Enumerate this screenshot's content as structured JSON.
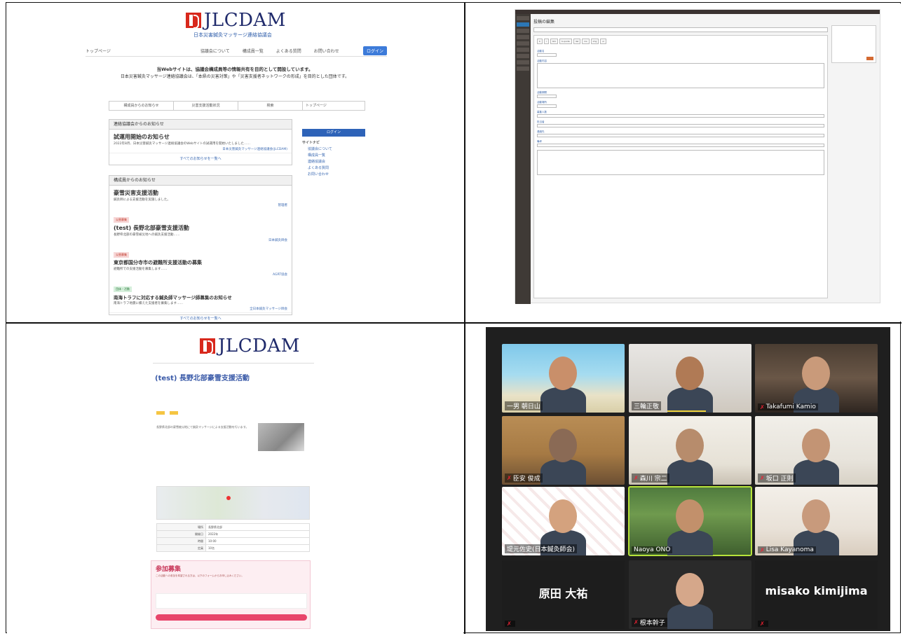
{
  "portal": {
    "logo_text": "JLCDAM",
    "logo_sub": "日本災害鍼灸マッサージ連絡協議会",
    "nav": [
      "トップページ",
      "協議会について",
      "構成員一覧",
      "よくある質問",
      "お問い合わせ",
      "ログイン"
    ],
    "intro_title": "当Webサイトは、協議会構成員等の情報共有を目的として開設しています。",
    "intro_body": "日本災害鍼灸マッサージ連絡協議会は、「本県の災害対策」や「災害支援者ネットワークの形成」を目的とした団体です。",
    "tabs": [
      "構成員からのお知らせ",
      "災害支援活動状況",
      "検索"
    ],
    "notice_header": "連絡協議会からのお知らせ",
    "notice_title": "試運用開始のお知らせ",
    "notice_text": "2022年8月、日本災害鍼灸マッサージ連絡協議会のWebサイトの試運用を開始いたしました……",
    "notice_author": "日本災害鍼灸マッサージ連絡協議会(JLCDAM)",
    "more_all": "すべてのお知らせを一覧へ",
    "member_header": "構成員からのお知らせ",
    "posts": [
      {
        "title": "豪雪災害支援活動",
        "text": "鍼灸師による支援活動を実施しました。",
        "author": "管理者"
      },
      {
        "title": "(test) 長野北部豪雪支援活動",
        "text": "長野県北部の豪雪被災地への鍼灸支援活動……",
        "author": "日本鍼灸師会"
      },
      {
        "title": "東京都国分寺市の避難所支援活動の募集",
        "text": "避難所での支援活動を募集します……",
        "author": "AGRT協会"
      },
      {
        "title": "南海トラフに対応する鍼灸師マッサージ師募集のお知らせ",
        "text": "南海トラフ地震に備えた支援者を募集します……",
        "author": "全日本鍼灸マッサージ師会"
      }
    ],
    "more_list": "すべてのお知らせを一覧へ",
    "tag_red": "災害募集",
    "tag_grn": "団体・活動",
    "side_top": "トップページ",
    "side_login": "ログイン",
    "side_nav_title": "サイトナビ",
    "side_links": [
      "協議会について",
      "構成員一覧",
      "連絡協議会",
      "よくある質問",
      "お問い合わせ"
    ]
  },
  "admin": {
    "title": "投稿の編集",
    "buttons": [
      "b",
      "i",
      "link",
      "b-quote",
      "del",
      "ins",
      "img",
      "ul",
      "ol",
      "li",
      "code",
      "more",
      "close tags"
    ],
    "fields": [
      "活動名",
      "活動内容",
      "活動期間",
      "活動場所",
      "募集人数",
      "担当者",
      "連絡先",
      "備考"
    ],
    "publish": "公開"
  },
  "event": {
    "logo_text": "JLCDAM",
    "title": "(test) 長野北部豪雪支援活動",
    "body": "長野県北部の豪雪被災地にて鍼灸マッサージによる支援活動を行います。",
    "table": [
      {
        "k": "場所",
        "v": "長野県北部"
      },
      {
        "k": "開催日",
        "v": "2022年"
      },
      {
        "k": "時間",
        "v": "10:00"
      },
      {
        "k": "定員",
        "v": "10名"
      }
    ],
    "join_title": "参加募集",
    "join_text": "この活動への参加を希望される方は、以下のフォームからお申し込みください。"
  },
  "call": {
    "participants": [
      {
        "name": "一男 朝日山",
        "muted": false
      },
      {
        "name": "三輪正敬",
        "muted": false
      },
      {
        "name": "Takafumi Kamio",
        "muted": true
      },
      {
        "name": "臣安 俊成",
        "muted": true
      },
      {
        "name": "森川 宗二",
        "muted": true
      },
      {
        "name": "坂口 正則",
        "muted": true
      },
      {
        "name": "堤元佐史(日本鍼灸師会)",
        "muted": false
      },
      {
        "name": "Naoya ONO",
        "muted": false
      },
      {
        "name": "Lisa Kayanoma",
        "muted": true
      },
      {
        "name": "",
        "muted": true
      },
      {
        "name": "根本幹子",
        "muted": true
      },
      {
        "name": "",
        "muted": true
      }
    ],
    "big_names": [
      "原田 大祐",
      "misako kimijima"
    ]
  }
}
